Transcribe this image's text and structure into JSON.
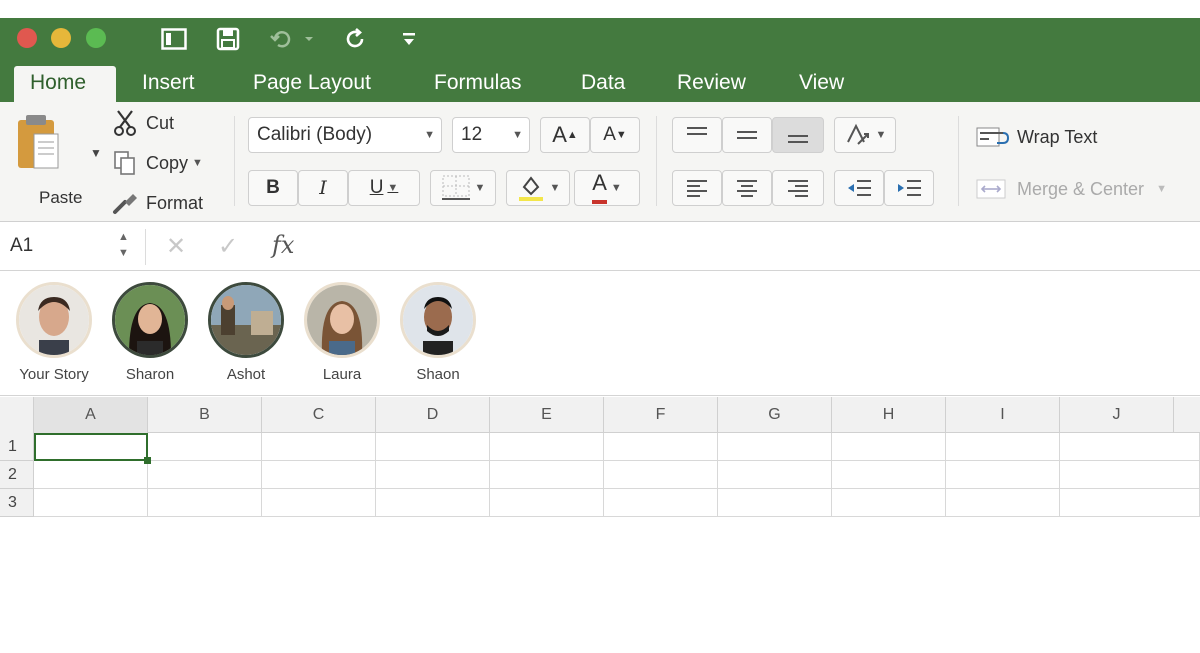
{
  "window": {
    "quick_access_icons": [
      "sidebar-icon",
      "save-icon",
      "undo-icon",
      "redo-icon",
      "customize-icon"
    ]
  },
  "tabs": [
    {
      "label": "Home",
      "active": true
    },
    {
      "label": "Insert",
      "active": false
    },
    {
      "label": "Page Layout",
      "active": false
    },
    {
      "label": "Formulas",
      "active": false
    },
    {
      "label": "Data",
      "active": false
    },
    {
      "label": "Review",
      "active": false
    },
    {
      "label": "View",
      "active": false
    }
  ],
  "ribbon": {
    "clipboard": {
      "paste_label": "Paste",
      "cut_label": "Cut",
      "copy_label": "Copy",
      "format_label": "Format"
    },
    "font": {
      "font_name": "Calibri (Body)",
      "font_size": "12",
      "grow_label": "A",
      "shrink_label": "A",
      "bold_label": "B",
      "italic_label": "I",
      "underline_label": "U",
      "font_color_label": "A"
    },
    "alignment": {
      "wrap_text_label": "Wrap Text",
      "merge_label": "Merge & Center"
    }
  },
  "formula_bar": {
    "name_box": "A1",
    "fx_label": "fx",
    "value": ""
  },
  "stories": [
    {
      "name": "Your Story",
      "ring": "faint"
    },
    {
      "name": "Sharon",
      "ring": "ring"
    },
    {
      "name": "Ashot",
      "ring": "ring"
    },
    {
      "name": "Laura",
      "ring": "faint"
    },
    {
      "name": "Shaon",
      "ring": "faint"
    }
  ],
  "sheet": {
    "columns": [
      "A",
      "B",
      "C",
      "D",
      "E",
      "F",
      "G",
      "H",
      "I",
      "J"
    ],
    "rows": [
      "1",
      "2",
      "3"
    ],
    "active_cell": "A1"
  },
  "colors": {
    "excel_green": "#447a3f",
    "ribbon_bg": "#f5f5f3",
    "selection": "#2f6e2c"
  }
}
